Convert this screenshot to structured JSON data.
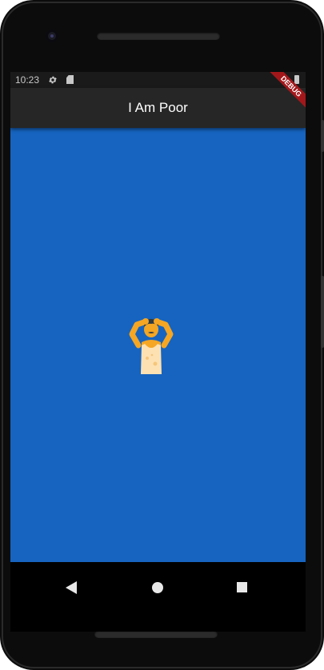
{
  "status_bar": {
    "time": "10:23",
    "icons": [
      "settings-icon",
      "sd-card-icon",
      "battery-icon"
    ]
  },
  "app_bar": {
    "title": "I Am Poor",
    "background": "#262626",
    "debug_banner": "DEBUG"
  },
  "body": {
    "background": "#1664c0",
    "image": "poor-man-illustration"
  },
  "nav_bar": {
    "buttons": [
      "back-icon",
      "home-icon",
      "recents-icon"
    ]
  }
}
